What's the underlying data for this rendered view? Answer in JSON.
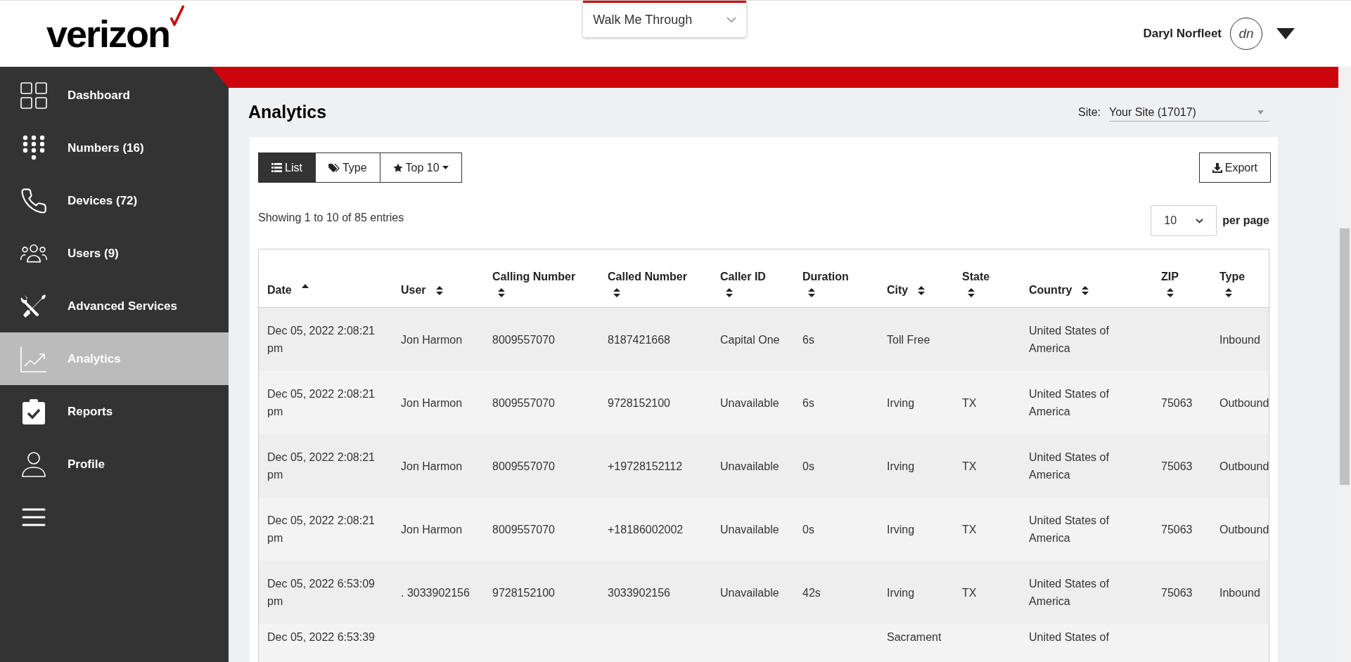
{
  "header": {
    "logo": "verizon",
    "walkthrough": "Walk Me Through",
    "user_name": "Daryl Norfleet",
    "avatar_initials": "dn"
  },
  "sidebar": {
    "items": [
      {
        "label": "Dashboard",
        "kind": "grid",
        "selected": false
      },
      {
        "label": "Numbers (16)",
        "kind": "dialpad",
        "selected": false
      },
      {
        "label": "Devices (72)",
        "kind": "phone",
        "selected": false
      },
      {
        "label": "Users (9)",
        "kind": "users",
        "selected": false
      },
      {
        "label": "Advanced Services",
        "kind": "tools",
        "selected": false
      },
      {
        "label": "Analytics",
        "kind": "chart",
        "selected": true
      },
      {
        "label": "Reports",
        "kind": "clipboard",
        "selected": false
      },
      {
        "label": "Profile",
        "kind": "user",
        "selected": false
      },
      {
        "kind": "menu",
        "selected": false
      }
    ]
  },
  "page": {
    "title": "Analytics",
    "site_label": "Site:",
    "site_value": "Your Site (17017)"
  },
  "view_tabs": [
    {
      "label": "List",
      "kind": "list",
      "selected": true
    },
    {
      "label": "Type",
      "kind": "tags",
      "selected": false
    },
    {
      "label": "Top 10",
      "kind": "star",
      "selected": false
    }
  ],
  "export_button": "Export",
  "summary": "Showing 1 to 10 of 85 entries",
  "per_page": {
    "value": "10",
    "label": "per page"
  },
  "table": {
    "columns": [
      {
        "label": "Date",
        "kind": "inline",
        "sorted_ascending": true
      },
      {
        "label": "User",
        "kind": "inline",
        "sorted_ascending": false
      },
      {
        "label": "Calling Number",
        "kind": "stacked",
        "sorted_ascending": false
      },
      {
        "label": "Called Number",
        "kind": "stacked",
        "sorted_ascending": false
      },
      {
        "label": "Caller ID",
        "kind": "stacked",
        "sorted_ascending": false
      },
      {
        "label": "Duration",
        "kind": "stacked",
        "sorted_ascending": false
      },
      {
        "label": "City",
        "kind": "inline",
        "sorted_ascending": false
      },
      {
        "label": "State",
        "kind": "stacked",
        "sorted_ascending": false
      },
      {
        "label": "Country",
        "kind": "inline",
        "sorted_ascending": false
      },
      {
        "label": "ZIP",
        "kind": "stacked",
        "sorted_ascending": false
      },
      {
        "label": "Type",
        "kind": "stacked",
        "sorted_ascending": false
      }
    ],
    "rows": [
      [
        "Dec 05, 2022 2:08:21 pm",
        "Jon Harmon",
        "8009557070",
        "8187421668",
        "Capital One",
        "6s",
        "Toll Free",
        "",
        "United States of America",
        "",
        "Inbound"
      ],
      [
        "Dec 05, 2022 2:08:21 pm",
        "Jon Harmon",
        "8009557070",
        "9728152100",
        "Unavailable",
        "6s",
        "Irving",
        "TX",
        "United States of America",
        "75063",
        "Outbound"
      ],
      [
        "Dec 05, 2022 2:08:21 pm",
        "Jon Harmon",
        "8009557070",
        "+19728152112",
        "Unavailable",
        "0s",
        "Irving",
        "TX",
        "United States of America",
        "75063",
        "Outbound"
      ],
      [
        "Dec 05, 2022 2:08:21 pm",
        "Jon Harmon",
        "8009557070",
        "+18186002002",
        "Unavailable",
        "0s",
        "Irving",
        "TX",
        "United States of America",
        "75063",
        "Outbound"
      ],
      [
        "Dec 05, 2022 6:53:09 pm",
        ". 3033902156",
        "9728152100",
        "3033902156",
        "Unavailable",
        "42s",
        "Irving",
        "TX",
        "United States of America",
        "75063",
        "Inbound"
      ],
      [
        "Dec 05, 2022 6:53:39",
        "",
        "",
        "",
        "",
        "",
        "Sacrament",
        "",
        "United States of",
        "",
        ""
      ]
    ]
  }
}
